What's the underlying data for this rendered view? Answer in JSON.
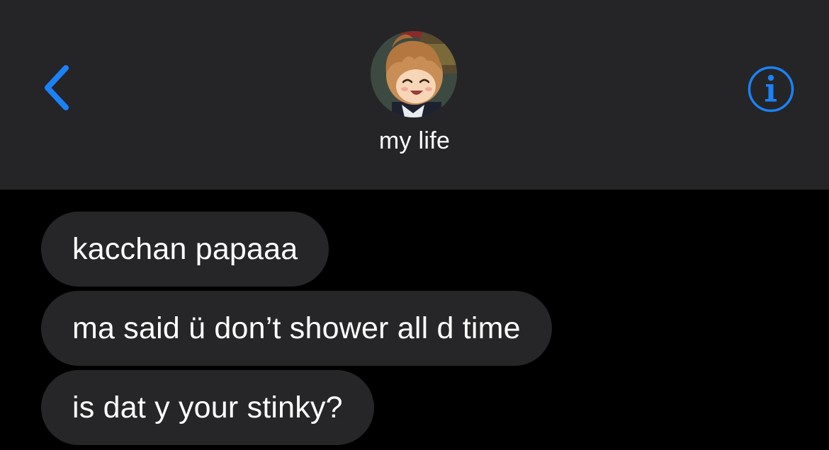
{
  "header": {
    "contact_name": "my life",
    "back_icon": "chevron-left-icon",
    "info_icon": "info-circle-icon",
    "accent_color": "#1a82f7",
    "background_color": "#252527"
  },
  "messages": [
    {
      "text": "kacchan papaaa",
      "direction": "incoming"
    },
    {
      "text": "ma said ü don’t shower all d time",
      "direction": "incoming"
    },
    {
      "text": "is dat y your stinky?",
      "direction": "incoming"
    }
  ],
  "colors": {
    "screen_background": "#000000",
    "incoming_bubble": "#262628",
    "text": "#ffffff"
  }
}
